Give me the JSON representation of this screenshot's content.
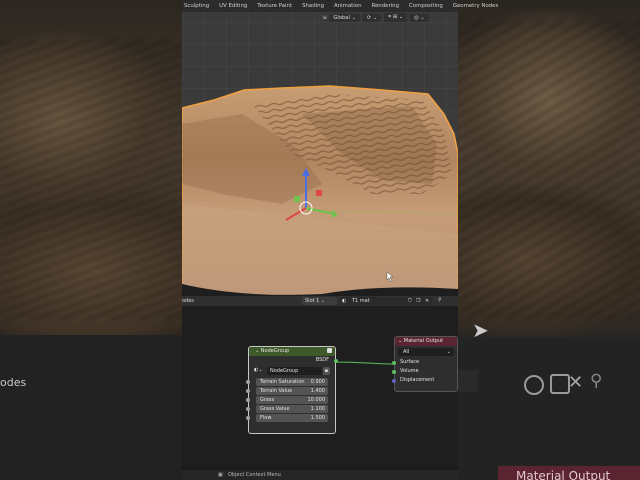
{
  "menu": {
    "tabs": [
      "Sculpting",
      "UV Editing",
      "Texture Paint",
      "Shading",
      "Animation",
      "Rendering",
      "Compositing",
      "Geometry Nodes"
    ]
  },
  "viewport_header": {
    "transform_orientation": "Global"
  },
  "node_editor": {
    "editor_label": "odes",
    "slot": "Slot 1",
    "material": "T1 mat",
    "status_item": "Object Context Menu"
  },
  "node_group": {
    "title": "NodeGroup",
    "output": "BSDF",
    "group_name": "NodeGroup",
    "inputs": [
      {
        "label": "Terrain Saturation",
        "value": "0.900"
      },
      {
        "label": "Terrain Value",
        "value": "1.400"
      },
      {
        "label": "Grass",
        "value": "10.000"
      },
      {
        "label": "Grass Value",
        "value": "1.100"
      },
      {
        "label": "Flow",
        "value": "1.500"
      }
    ]
  },
  "material_output": {
    "title": "Material Output",
    "target": "All",
    "sockets": [
      "Surface",
      "Volume",
      "Displacement"
    ]
  },
  "background": {
    "left_label": "odes",
    "right_title": "Material Output"
  },
  "colors": {
    "node_group_header": "#3f5a2a",
    "material_output_header": "#5a2430",
    "socket_shader": "#5fbf5f",
    "socket_value": "#a0a0a0",
    "socket_vector": "#6363c7",
    "selection_outline": "#f0a040"
  }
}
